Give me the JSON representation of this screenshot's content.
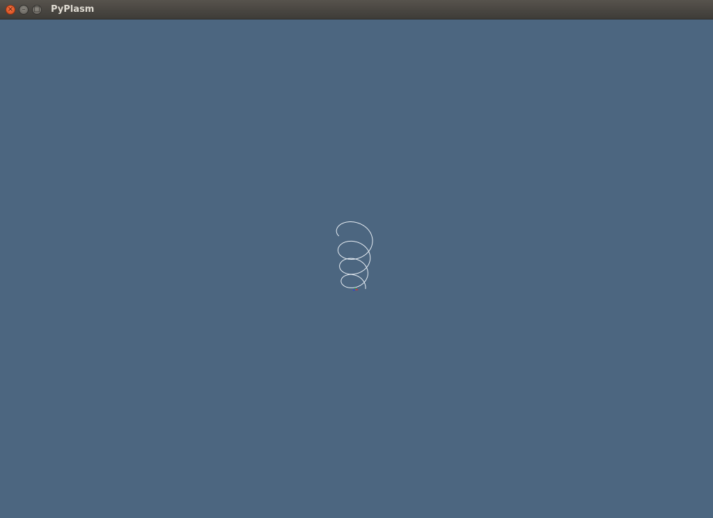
{
  "window": {
    "title": "PyPlasm",
    "buttons": {
      "close_glyph": "×",
      "minimize_glyph": "–",
      "maximize_glyph": "□"
    }
  },
  "colors": {
    "viewport_background": "#4c6680",
    "curve_stroke": "#e8eef4",
    "axis_x": "#d03030",
    "axis_y": "#30b040",
    "axis_z": "#3040d0"
  },
  "scene": {
    "object": "helix-curve"
  }
}
